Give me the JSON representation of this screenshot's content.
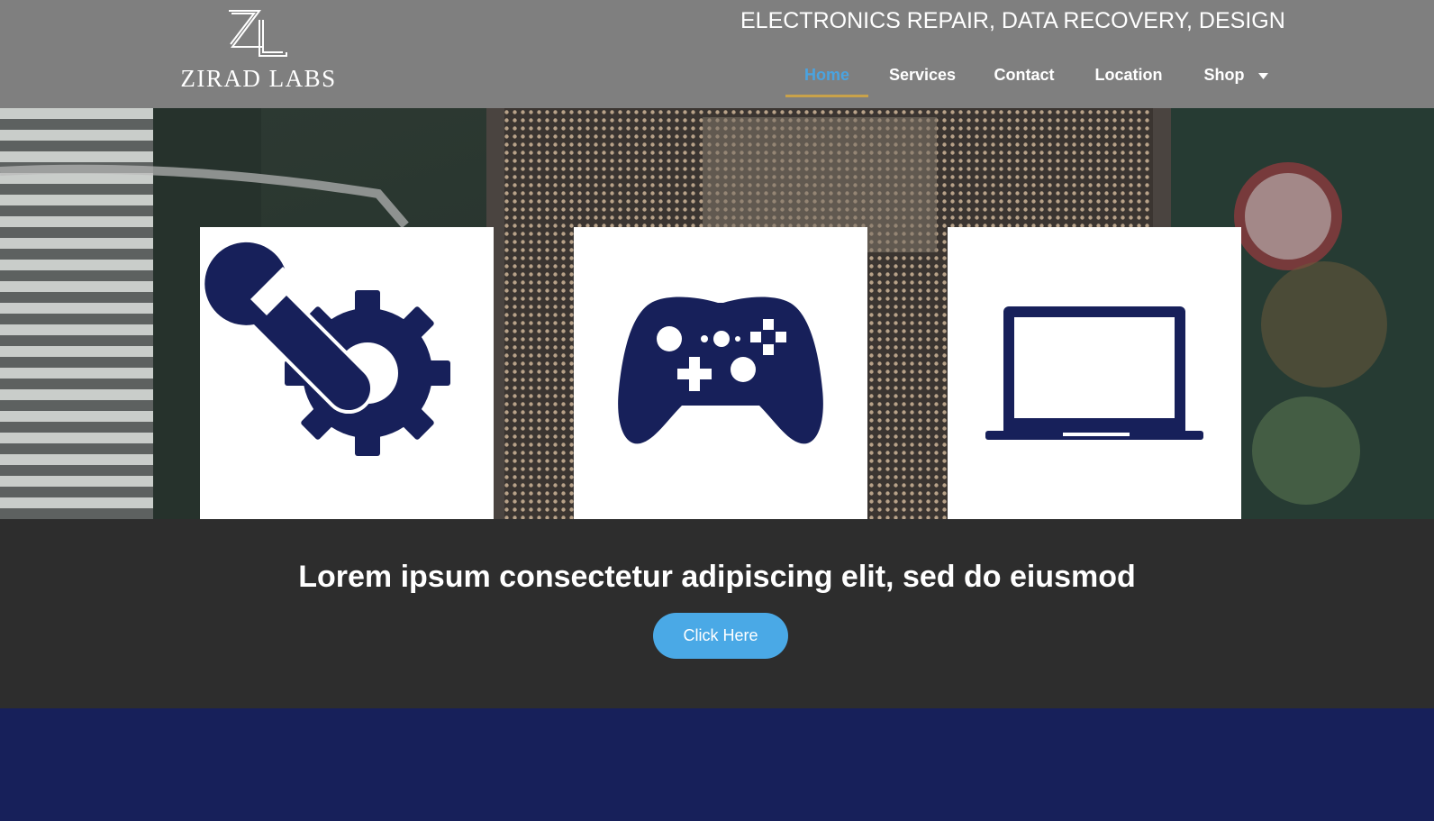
{
  "header": {
    "brand": "ZIRAD LABS",
    "tagline": "ELECTRONICS REPAIR, DATA RECOVERY, DESIGN",
    "nav": [
      {
        "label": "Home",
        "active": true
      },
      {
        "label": "Services",
        "active": false
      },
      {
        "label": "Contact",
        "active": false
      },
      {
        "label": "Location",
        "active": false
      },
      {
        "label": "Shop",
        "active": false,
        "has_dropdown": true
      }
    ]
  },
  "hero": {
    "background": "circuit-board-photo",
    "cards": [
      {
        "icon": "wrench-gear-icon"
      },
      {
        "icon": "gamepad-icon"
      },
      {
        "icon": "laptop-icon"
      }
    ]
  },
  "cta": {
    "heading": "Lorem ipsum consectetur adipiscing elit, sed do eiusmod",
    "button_label": "Click Here"
  },
  "colors": {
    "header_bg": "#7f7f7f",
    "nav_active": "#4aa3e0",
    "nav_underline": "#c9a24a",
    "icon_navy": "#17205a",
    "cta_bg": "#2d2d2d",
    "button_bg": "#4aa9e6",
    "footer_bg": "#17205a"
  }
}
